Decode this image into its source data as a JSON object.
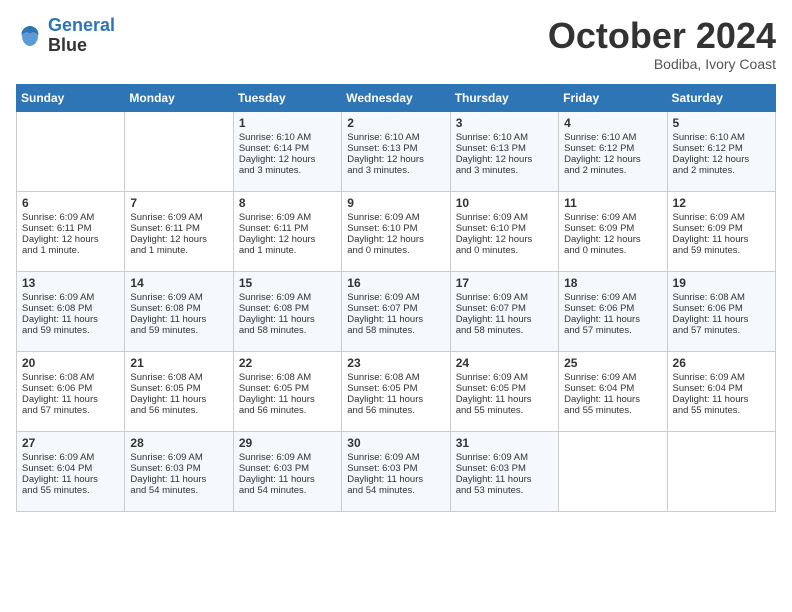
{
  "header": {
    "logo_line1": "General",
    "logo_line2": "Blue",
    "month": "October 2024",
    "location": "Bodiba, Ivory Coast"
  },
  "days_of_week": [
    "Sunday",
    "Monday",
    "Tuesday",
    "Wednesday",
    "Thursday",
    "Friday",
    "Saturday"
  ],
  "weeks": [
    [
      {
        "day": "",
        "info": ""
      },
      {
        "day": "",
        "info": ""
      },
      {
        "day": "1",
        "info": "Sunrise: 6:10 AM\nSunset: 6:14 PM\nDaylight: 12 hours\nand 3 minutes."
      },
      {
        "day": "2",
        "info": "Sunrise: 6:10 AM\nSunset: 6:13 PM\nDaylight: 12 hours\nand 3 minutes."
      },
      {
        "day": "3",
        "info": "Sunrise: 6:10 AM\nSunset: 6:13 PM\nDaylight: 12 hours\nand 3 minutes."
      },
      {
        "day": "4",
        "info": "Sunrise: 6:10 AM\nSunset: 6:12 PM\nDaylight: 12 hours\nand 2 minutes."
      },
      {
        "day": "5",
        "info": "Sunrise: 6:10 AM\nSunset: 6:12 PM\nDaylight: 12 hours\nand 2 minutes."
      }
    ],
    [
      {
        "day": "6",
        "info": "Sunrise: 6:09 AM\nSunset: 6:11 PM\nDaylight: 12 hours\nand 1 minute."
      },
      {
        "day": "7",
        "info": "Sunrise: 6:09 AM\nSunset: 6:11 PM\nDaylight: 12 hours\nand 1 minute."
      },
      {
        "day": "8",
        "info": "Sunrise: 6:09 AM\nSunset: 6:11 PM\nDaylight: 12 hours\nand 1 minute."
      },
      {
        "day": "9",
        "info": "Sunrise: 6:09 AM\nSunset: 6:10 PM\nDaylight: 12 hours\nand 0 minutes."
      },
      {
        "day": "10",
        "info": "Sunrise: 6:09 AM\nSunset: 6:10 PM\nDaylight: 12 hours\nand 0 minutes."
      },
      {
        "day": "11",
        "info": "Sunrise: 6:09 AM\nSunset: 6:09 PM\nDaylight: 12 hours\nand 0 minutes."
      },
      {
        "day": "12",
        "info": "Sunrise: 6:09 AM\nSunset: 6:09 PM\nDaylight: 11 hours\nand 59 minutes."
      }
    ],
    [
      {
        "day": "13",
        "info": "Sunrise: 6:09 AM\nSunset: 6:08 PM\nDaylight: 11 hours\nand 59 minutes."
      },
      {
        "day": "14",
        "info": "Sunrise: 6:09 AM\nSunset: 6:08 PM\nDaylight: 11 hours\nand 59 minutes."
      },
      {
        "day": "15",
        "info": "Sunrise: 6:09 AM\nSunset: 6:08 PM\nDaylight: 11 hours\nand 58 minutes."
      },
      {
        "day": "16",
        "info": "Sunrise: 6:09 AM\nSunset: 6:07 PM\nDaylight: 11 hours\nand 58 minutes."
      },
      {
        "day": "17",
        "info": "Sunrise: 6:09 AM\nSunset: 6:07 PM\nDaylight: 11 hours\nand 58 minutes."
      },
      {
        "day": "18",
        "info": "Sunrise: 6:09 AM\nSunset: 6:06 PM\nDaylight: 11 hours\nand 57 minutes."
      },
      {
        "day": "19",
        "info": "Sunrise: 6:08 AM\nSunset: 6:06 PM\nDaylight: 11 hours\nand 57 minutes."
      }
    ],
    [
      {
        "day": "20",
        "info": "Sunrise: 6:08 AM\nSunset: 6:06 PM\nDaylight: 11 hours\nand 57 minutes."
      },
      {
        "day": "21",
        "info": "Sunrise: 6:08 AM\nSunset: 6:05 PM\nDaylight: 11 hours\nand 56 minutes."
      },
      {
        "day": "22",
        "info": "Sunrise: 6:08 AM\nSunset: 6:05 PM\nDaylight: 11 hours\nand 56 minutes."
      },
      {
        "day": "23",
        "info": "Sunrise: 6:08 AM\nSunset: 6:05 PM\nDaylight: 11 hours\nand 56 minutes."
      },
      {
        "day": "24",
        "info": "Sunrise: 6:09 AM\nSunset: 6:05 PM\nDaylight: 11 hours\nand 55 minutes."
      },
      {
        "day": "25",
        "info": "Sunrise: 6:09 AM\nSunset: 6:04 PM\nDaylight: 11 hours\nand 55 minutes."
      },
      {
        "day": "26",
        "info": "Sunrise: 6:09 AM\nSunset: 6:04 PM\nDaylight: 11 hours\nand 55 minutes."
      }
    ],
    [
      {
        "day": "27",
        "info": "Sunrise: 6:09 AM\nSunset: 6:04 PM\nDaylight: 11 hours\nand 55 minutes."
      },
      {
        "day": "28",
        "info": "Sunrise: 6:09 AM\nSunset: 6:03 PM\nDaylight: 11 hours\nand 54 minutes."
      },
      {
        "day": "29",
        "info": "Sunrise: 6:09 AM\nSunset: 6:03 PM\nDaylight: 11 hours\nand 54 minutes."
      },
      {
        "day": "30",
        "info": "Sunrise: 6:09 AM\nSunset: 6:03 PM\nDaylight: 11 hours\nand 54 minutes."
      },
      {
        "day": "31",
        "info": "Sunrise: 6:09 AM\nSunset: 6:03 PM\nDaylight: 11 hours\nand 53 minutes."
      },
      {
        "day": "",
        "info": ""
      },
      {
        "day": "",
        "info": ""
      }
    ]
  ]
}
